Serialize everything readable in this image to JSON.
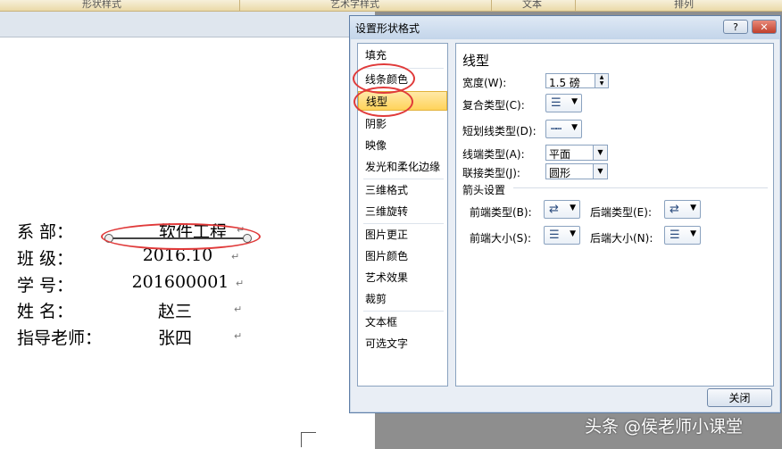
{
  "ribbon": {
    "groups": [
      "形状样式",
      "艺术字样式",
      "文本",
      "排列"
    ]
  },
  "document": {
    "lines": [
      {
        "label": "系 部：",
        "value": "软件工程"
      },
      {
        "label": "班 级：",
        "value": "2016.10"
      },
      {
        "label": "学 号：",
        "value": "201600001"
      },
      {
        "label": "姓 名：",
        "value": "赵三"
      },
      {
        "label": "指导老师：",
        "value": "张四"
      }
    ],
    "paragraph_mark": "↵"
  },
  "dialog": {
    "title": "设置形状格式",
    "help_label": "?",
    "close_label": "✕",
    "nav_items": [
      "填充",
      "线条颜色",
      "线型",
      "阴影",
      "映像",
      "发光和柔化边缘",
      "三维格式",
      "三维旋转",
      "图片更正",
      "图片颜色",
      "艺术效果",
      "裁剪",
      "文本框",
      "可选文字"
    ],
    "selected_nav": "线型",
    "section_title": "线型",
    "width": {
      "label": "宽度(W):",
      "value": "1.5 磅"
    },
    "compound": {
      "label": "复合类型(C):",
      "icon": "compound-lines-icon"
    },
    "dash": {
      "label": "短划线类型(D):",
      "icon": "dash-lines-icon"
    },
    "cap": {
      "label": "线端类型(A):",
      "value": "平面"
    },
    "join": {
      "label": "联接类型(J):",
      "value": "圆形"
    },
    "arrow_settings": {
      "title": "箭头设置",
      "begin_type": "前端类型(B):",
      "end_type": "后端类型(E):",
      "begin_size": "前端大小(S):",
      "end_size": "后端大小(N):"
    },
    "close_button": "关闭"
  },
  "watermark": "头条 @侯老师小课堂",
  "colors": {
    "annotation": "#e03a3a",
    "selected_nav": "#ffd35a",
    "dialog_border": "#5f7fa8"
  }
}
